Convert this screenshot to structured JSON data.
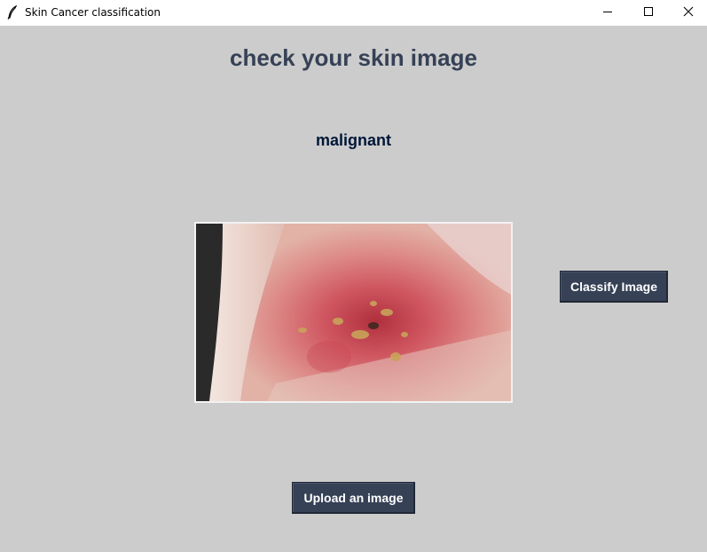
{
  "window": {
    "title": "Skin Cancer classification",
    "icon": "feather-icon",
    "controls": [
      "minimize-icon",
      "maximize-icon",
      "close-icon"
    ]
  },
  "main": {
    "heading": "check your skin image",
    "result": "malignant",
    "classify_label": "Classify Image",
    "upload_label": "Upload an image"
  },
  "colors": {
    "background": "#cccccc",
    "heading": "#364156",
    "result": "#011638",
    "button_bg": "#364156",
    "button_text": "#ffffff"
  }
}
